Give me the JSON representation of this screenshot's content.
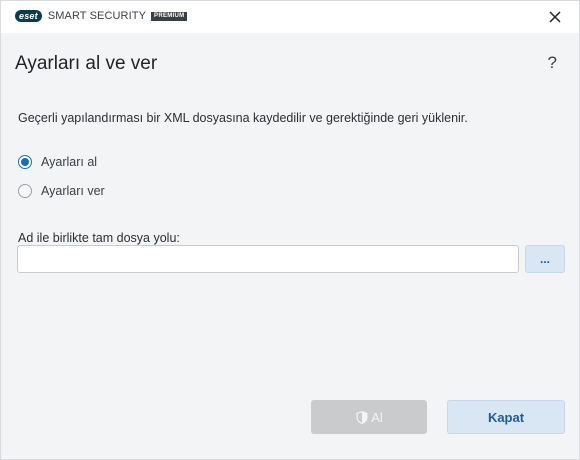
{
  "titlebar": {
    "brand": "eset",
    "product": "SMART SECURITY",
    "edition": "PREMIUM"
  },
  "dialog": {
    "title": "Ayarları al ve ver",
    "help": "?",
    "description": "Geçerli yapılandırması bir XML dosyasına kaydedilir ve gerektiğinde geri yüklenir.",
    "options": [
      {
        "label": "Ayarları al",
        "selected": true
      },
      {
        "label": "Ayarları ver",
        "selected": false
      }
    ],
    "path_label": "Ad ile birlikte tam dosya yolu:",
    "path_value": "",
    "browse_label": "...",
    "import_button": "Al",
    "close_button": "Kapat"
  },
  "colors": {
    "accent": "#1c6fb6",
    "button_bg": "#d9e6f4",
    "disabled_bg": "#c9cbcd",
    "window_bg": "#f3f4f6"
  },
  "icons": {
    "close": "close-icon",
    "admin_shield": "shield-icon"
  }
}
